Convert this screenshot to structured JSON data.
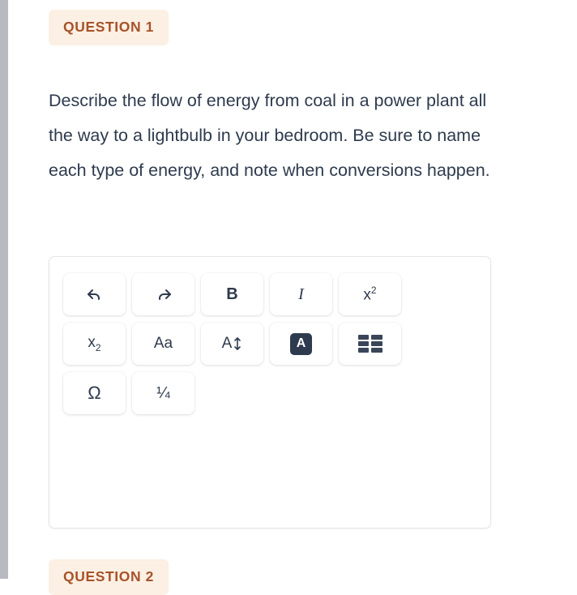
{
  "page": {
    "background_color": "#ffffff",
    "text_color": "#2e3b4e"
  },
  "scrollbar": {
    "name": "vertical-scrollbar",
    "track_color": "#eceef0",
    "thumb_color": "#b9babf",
    "position": "left"
  },
  "questions": [
    {
      "badge_label": "QUESTION 1",
      "badge_background": "#fbf0e3",
      "badge_text_color": "#a8522a",
      "prompt": "Describe the flow of energy from coal in a power plant all the way to a lightbulb in your bedroom. Be sure to name each type of energy, and note when conversions happen."
    },
    {
      "badge_label": "QUESTION 2",
      "badge_background": "#fbf0e3",
      "badge_text_color": "#a8522a"
    }
  ],
  "editor": {
    "name": "rich-text-answer-editor",
    "border_color": "#e3e5e8",
    "answer_value": "",
    "answer_placeholder": "",
    "toolbar": {
      "active_button": "text-color",
      "active_chip_color": "#2e3b4e",
      "buttons": [
        {
          "id": "undo",
          "icon": "undo-arrow-icon",
          "label": ""
        },
        {
          "id": "redo",
          "icon": "redo-arrow-icon",
          "label": ""
        },
        {
          "id": "bold",
          "icon": "bold-icon",
          "label": "B"
        },
        {
          "id": "italic",
          "icon": "italic-icon",
          "label": "I"
        },
        {
          "id": "superscript",
          "icon": "superscript-icon",
          "label": "x",
          "sup": "2"
        },
        {
          "id": "subscript",
          "icon": "subscript-icon",
          "label": "x",
          "sub": "2"
        },
        {
          "id": "font-family",
          "icon": "font-family-icon",
          "label": "Aa"
        },
        {
          "id": "line-height",
          "icon": "line-height-icon",
          "label": "A"
        },
        {
          "id": "text-color",
          "icon": "text-color-icon",
          "label": "A"
        },
        {
          "id": "table",
          "icon": "table-grid-icon",
          "label": ""
        },
        {
          "id": "symbol",
          "icon": "omega-symbol-icon",
          "label": "Ω"
        },
        {
          "id": "fraction",
          "icon": "fraction-icon",
          "label": "¼"
        }
      ]
    }
  }
}
